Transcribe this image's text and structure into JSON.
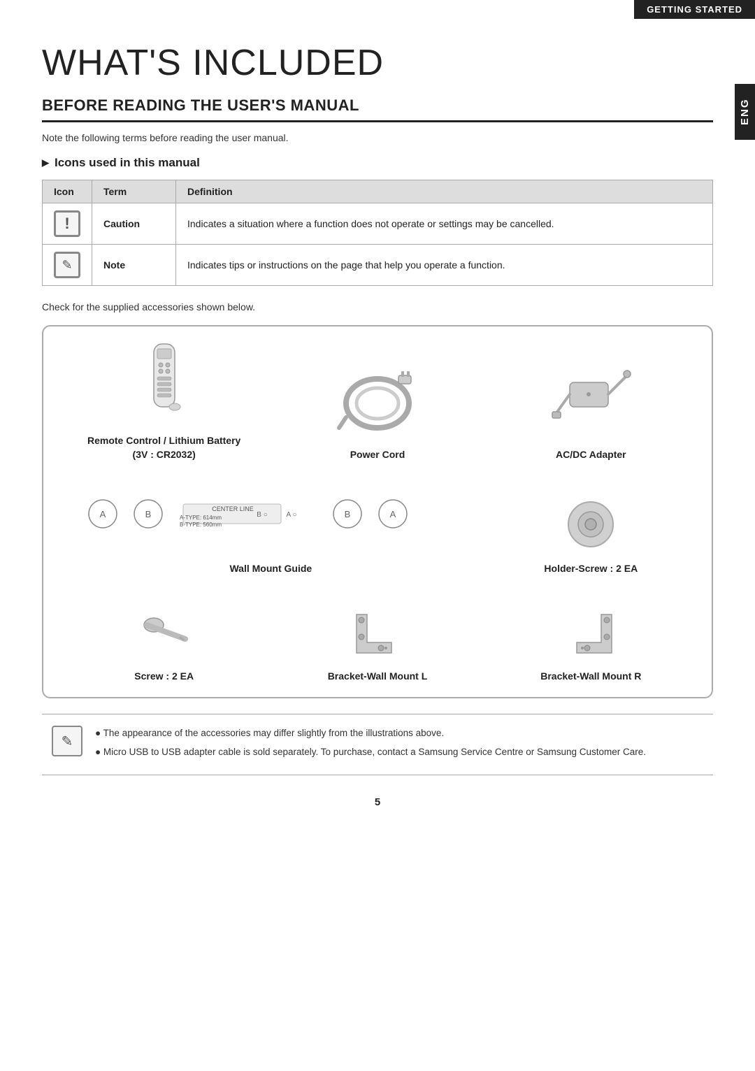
{
  "header": {
    "getting_started": "GETTING STARTED",
    "language_tab": "ENG"
  },
  "page_title": "WHAT'S INCLUDED",
  "section_title": "BEFORE READING THE USER'S MANUAL",
  "intro_text": "Note the following terms before reading the user manual.",
  "icons_subsection_title": "Icons used in this manual",
  "icons_table": {
    "col_icon": "Icon",
    "col_term": "Term",
    "col_definition": "Definition",
    "rows": [
      {
        "term": "Caution",
        "definition": "Indicates a situation where a function does not operate or settings may be cancelled."
      },
      {
        "term": "Note",
        "definition": "Indicates tips or instructions on the page that help you operate a function."
      }
    ]
  },
  "check_text": "Check for the supplied accessories shown below.",
  "accessories": {
    "item1_label": "Remote Control / Lithium Battery\n(3V : CR2032)",
    "item1_label_line1": "Remote Control / Lithium Battery",
    "item1_label_line2": "(3V : CR2032)",
    "item2_label": "Power Cord",
    "item3_label": "AC/DC Adapter",
    "item4_label": "Wall Mount Guide",
    "item5_label": "Holder-Screw : 2 EA",
    "item6_label": "Screw : 2 EA",
    "item7_label": "Bracket-Wall Mount L",
    "item8_label": "Bracket-Wall Mount R"
  },
  "notes": {
    "bullet1": "The appearance of the accessories may differ slightly from the illustrations above.",
    "bullet2": "Micro USB to USB adapter cable is sold separately. To purchase, contact a Samsung Service Centre or Samsung Customer Care."
  },
  "page_number": "5"
}
